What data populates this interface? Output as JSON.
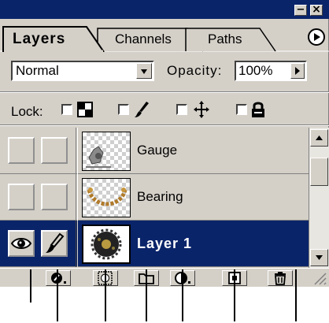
{
  "window": {
    "minimize_label": "−",
    "close_label": "×"
  },
  "tabs": [
    {
      "label": "Layers",
      "active": true
    },
    {
      "label": "Channels",
      "active": false
    },
    {
      "label": "Paths",
      "active": false
    }
  ],
  "blend": {
    "mode": "Normal",
    "opacity_label": "Opacity:",
    "opacity_value": "100%"
  },
  "lock": {
    "label": "Lock:",
    "options": [
      "lock-transparency-icon",
      "lock-image-icon",
      "lock-position-icon",
      "lock-all-icon"
    ]
  },
  "layers": [
    {
      "name": "Gauge",
      "visible": false,
      "selected": false
    },
    {
      "name": "Bearing",
      "visible": false,
      "selected": false
    },
    {
      "name": "Layer 1",
      "visible": true,
      "selected": true
    }
  ],
  "bottom_buttons": [
    "layer-style-icon",
    "add-mask-icon",
    "new-set-icon",
    "new-adjustment-layer-icon",
    "new-layer-icon",
    "delete-layer-icon"
  ],
  "colors": {
    "titlebar": "#0a246a",
    "selection": "#0a246a",
    "panel": "#d4d0c8"
  }
}
